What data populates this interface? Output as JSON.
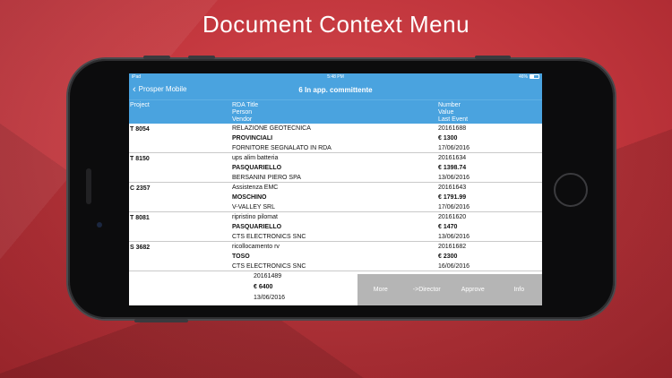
{
  "promo": {
    "title": "Document Context Menu"
  },
  "status_bar": {
    "carrier": "iPad",
    "time": "5:48 PM",
    "battery": "46%"
  },
  "nav": {
    "back_label": "Prosper Mobile",
    "title": "6 In app. committente"
  },
  "columns": {
    "project": "Project",
    "rda_title": "RDA Title",
    "person": "Person",
    "vendor": "Vendor",
    "number": "Number",
    "value": "Value",
    "last_event": "Last Event"
  },
  "rows": [
    {
      "project": "T 8054",
      "title": "RELAZIONE GEOTECNICA",
      "person": "PROVINCIALI",
      "vendor": "FORNITORE SEGNALATO IN RDA",
      "number": "20161688",
      "value": "€ 1300",
      "date": "17/06/2016"
    },
    {
      "project": "T 8150",
      "title": "ups alim batteria",
      "person": "PASQUARIELLO",
      "vendor": "BERSANINI PIERO SPA",
      "number": "20161634",
      "value": "€ 1398.74",
      "date": "13/06/2016"
    },
    {
      "project": "C 2357",
      "title": "Assistenza EMC",
      "person": "MOSCHINO",
      "vendor": "V-VALLEY SRL",
      "number": "20161643",
      "value": "€ 1791.99",
      "date": "17/06/2016"
    },
    {
      "project": "T 8081",
      "title": "ripristino pilomat",
      "person": "PASQUARIELLO",
      "vendor": "CTS ELECTRONICS SNC",
      "number": "20161620",
      "value": "€ 1470",
      "date": "13/06/2016"
    },
    {
      "project": "S 3682",
      "title": "ricollocamento rv",
      "person": "TOSO",
      "vendor": "CTS ELECTRONICS SNC",
      "number": "20161682",
      "value": "€ 2300",
      "date": "16/06/2016"
    }
  ],
  "swiped_row": {
    "number": "20161489",
    "value": "€ 6400",
    "date": "13/06/2016"
  },
  "actions": {
    "more": "More",
    "director": "->Director",
    "approve": "Approve",
    "info": "Info"
  }
}
